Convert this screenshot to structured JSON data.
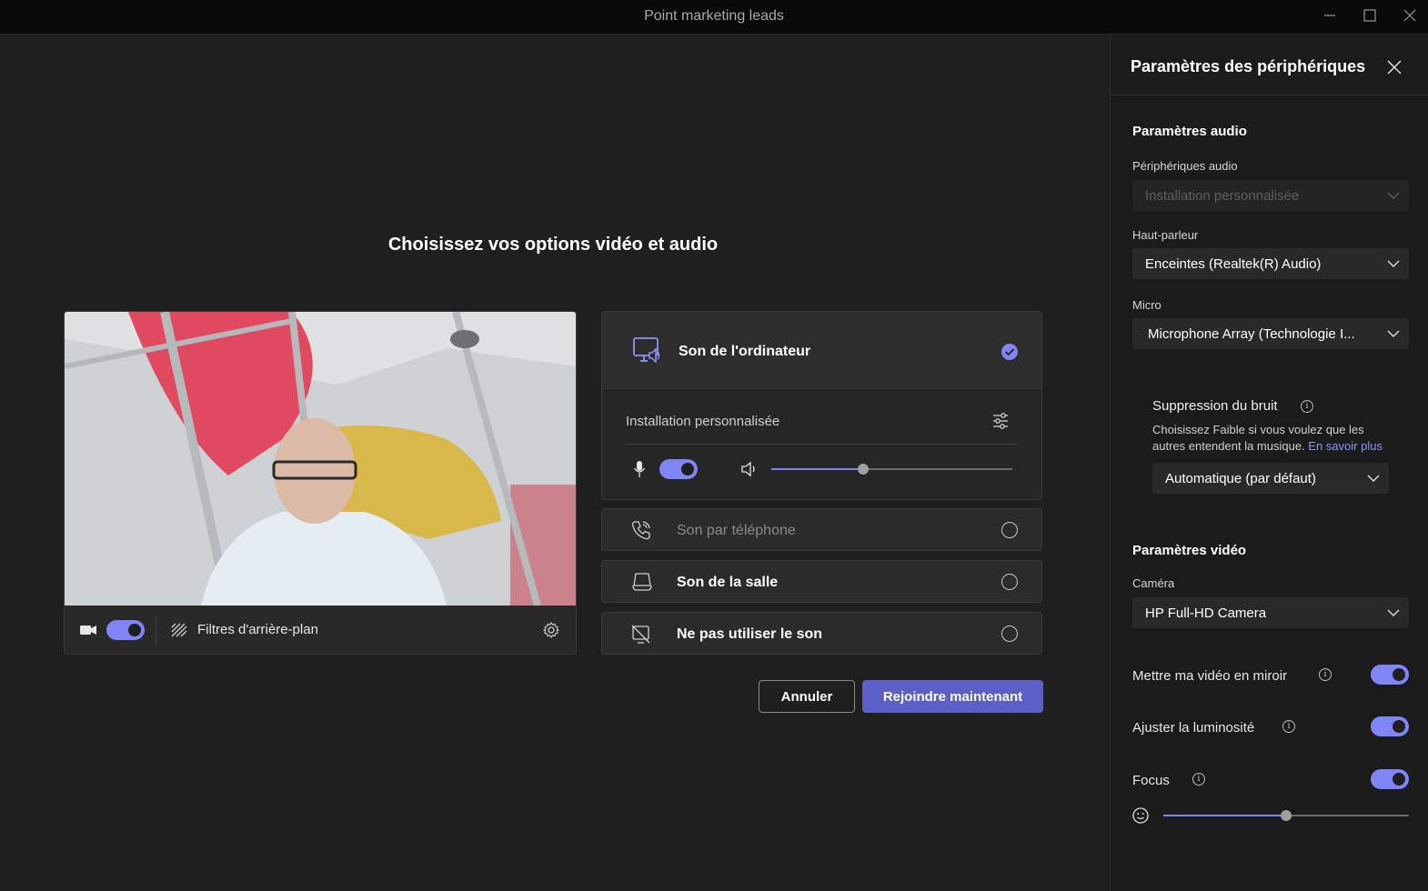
{
  "window": {
    "title": "Point marketing leads"
  },
  "main": {
    "heading": "Choisissez vos options vidéo et audio",
    "video": {
      "camera_on": true,
      "background_filters_label": "Filtres d'arrière-plan"
    },
    "audio_options": {
      "computer": {
        "label": "Son de l'ordinateur",
        "selected": true,
        "device_label": "Installation personnalisée",
        "mic_on": true,
        "volume_fraction": 0.38
      },
      "phone": {
        "label": "Son par téléphone",
        "selected": false
      },
      "room": {
        "label": "Son de la salle",
        "selected": false
      },
      "none": {
        "label": "Ne pas utiliser le son",
        "selected": false
      }
    },
    "buttons": {
      "cancel": "Annuler",
      "join": "Rejoindre maintenant"
    }
  },
  "side": {
    "title": "Paramètres des périphériques",
    "audio": {
      "section_title": "Paramètres audio",
      "devices_label": "Périphériques audio",
      "devices_value": "Installation personnalisée",
      "speaker_label": "Haut-parleur",
      "speaker_value": "Enceintes (Realtek(R) Audio)",
      "mic_label": "Micro",
      "mic_value": "Microphone Array (Technologie I...",
      "noise_title": "Suppression du bruit",
      "noise_desc": "Choisissez Faible si vous voulez que les autres entendent la musique.",
      "noise_link": "En savoir plus",
      "noise_value": "Automatique (par défaut)"
    },
    "video": {
      "section_title": "Paramètres vidéo",
      "camera_label": "Caméra",
      "camera_value": "HP Full-HD Camera",
      "mirror_label": "Mettre ma vidéo en miroir",
      "mirror_on": true,
      "brightness_label": "Ajuster la luminosité",
      "brightness_on": true,
      "focus_label": "Focus",
      "focus_on": true,
      "focus_fraction": 0.5
    }
  },
  "colors": {
    "accent": "#7f85f5",
    "button_primary": "#5b5fc7",
    "background": "#1f1f1f",
    "panel": "#1b1b1b"
  }
}
